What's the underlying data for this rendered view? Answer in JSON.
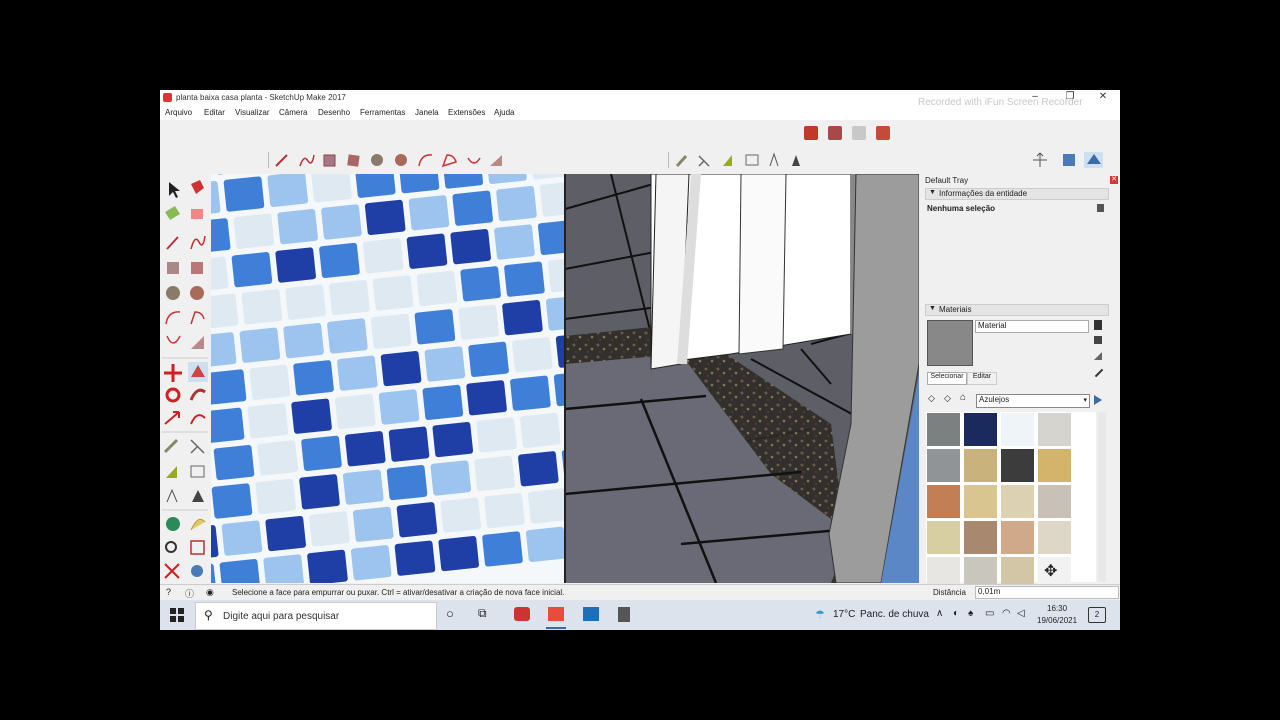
{
  "window": {
    "title": "planta baixa casa planta - SketchUp Make 2017",
    "watermark": "Recorded with iFun Screen Recorder",
    "controls": [
      "–",
      "❐",
      "✕"
    ]
  },
  "menu": [
    "Arquivo",
    "Editar",
    "Visualizar",
    "Câmera",
    "Desenho",
    "Ferramentas",
    "Janela",
    "Extensões",
    "Ajuda"
  ],
  "tray": {
    "title": "Default Tray",
    "entity_panel": {
      "title": "Informações da entidade",
      "selection": "Nenhuma seleção"
    },
    "materials_panel": {
      "title": "Materiais",
      "material_name": "Material",
      "tabs": [
        "Selecionar",
        "Editar"
      ],
      "collection": "Azulejos",
      "swatch_colors": [
        "#7c8080",
        "#1b2a5c",
        "#eef4f8",
        "#d6d4cf",
        "#909496",
        "#c9b27c",
        "#3c3c3c",
        "#d4b46a",
        "#c27f55",
        "#d8c58f",
        "#ddd1b3",
        "#c9c1b7",
        "#d7cfa2",
        "#a98870",
        "#d0a88a",
        "#ded6c7",
        "#e8e6e2",
        "#c9c6be",
        "#d2c6a6",
        "#f2f2f2"
      ]
    }
  },
  "status": {
    "hint": "Selecione a face para empurrar ou puxar. Ctrl = ativar/desativar a criação de nova face inicial.",
    "measurement_label": "Distância",
    "measurement_value": "0,01m"
  },
  "taskbar": {
    "search_placeholder": "Digite aqui para pesquisar",
    "weather_temp": "17°C",
    "weather_text": "Panc. de chuva",
    "time": "16:30",
    "date": "19/06/2021",
    "notification_count": "2"
  },
  "colors": {
    "tile_dark_blue": "#1f3fa6",
    "tile_mid_blue": "#3f7fd8",
    "tile_light_blue": "#9cc4ee",
    "tile_white": "#dfe9f2",
    "grout": "#f4f8fb",
    "floor_tile": "#6e6e78",
    "granite": "#2d2a26",
    "wall": "#ffffff",
    "wall_shadow": "#9c9c9c"
  }
}
